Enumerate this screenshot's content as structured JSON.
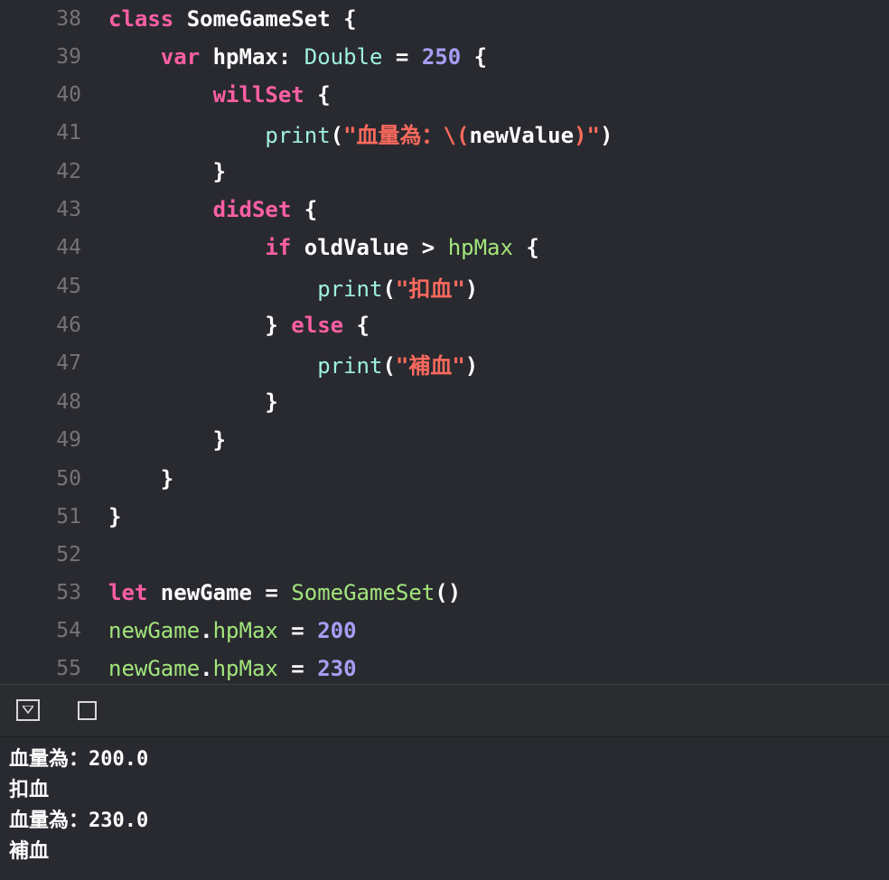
{
  "editor": {
    "lines": [
      {
        "no": "38",
        "parts": [
          [
            "kw",
            "class"
          ],
          [
            "plain",
            " SomeGameSet {"
          ]
        ]
      },
      {
        "no": "39",
        "parts": [
          [
            "plain",
            "    "
          ],
          [
            "kw",
            "var"
          ],
          [
            "plain",
            " hpMax: "
          ],
          [
            "type",
            "Double"
          ],
          [
            "plain",
            " = "
          ],
          [
            "num2",
            "250"
          ],
          [
            "plain",
            " {"
          ]
        ]
      },
      {
        "no": "40",
        "parts": [
          [
            "plain",
            "        "
          ],
          [
            "kw",
            "willSet"
          ],
          [
            "plain",
            " {"
          ]
        ]
      },
      {
        "no": "41",
        "parts": [
          [
            "plain",
            "            "
          ],
          [
            "fn",
            "print"
          ],
          [
            "plain",
            "("
          ],
          [
            "str",
            "\"血量為：\\("
          ],
          [
            "plain",
            "newValue"
          ],
          [
            "str",
            ")\""
          ],
          [
            "plain",
            ")"
          ]
        ]
      },
      {
        "no": "42",
        "parts": [
          [
            "plain",
            "        }"
          ]
        ]
      },
      {
        "no": "43",
        "parts": [
          [
            "plain",
            "        "
          ],
          [
            "kw",
            "didSet"
          ],
          [
            "plain",
            " {"
          ]
        ]
      },
      {
        "no": "44",
        "parts": [
          [
            "plain",
            "            "
          ],
          [
            "kw",
            "if"
          ],
          [
            "plain",
            " oldValue > "
          ],
          [
            "fnb",
            "hpMax"
          ],
          [
            "plain",
            " {"
          ]
        ]
      },
      {
        "no": "45",
        "parts": [
          [
            "plain",
            "                "
          ],
          [
            "fn",
            "print"
          ],
          [
            "plain",
            "("
          ],
          [
            "str",
            "\"扣血\""
          ],
          [
            "plain",
            ")"
          ]
        ]
      },
      {
        "no": "46",
        "parts": [
          [
            "plain",
            "            } "
          ],
          [
            "kw",
            "else"
          ],
          [
            "plain",
            " {"
          ]
        ]
      },
      {
        "no": "47",
        "parts": [
          [
            "plain",
            "                "
          ],
          [
            "fn",
            "print"
          ],
          [
            "plain",
            "("
          ],
          [
            "str",
            "\"補血\""
          ],
          [
            "plain",
            ")"
          ]
        ]
      },
      {
        "no": "48",
        "parts": [
          [
            "plain",
            "            }"
          ]
        ]
      },
      {
        "no": "49",
        "parts": [
          [
            "plain",
            "        }"
          ]
        ]
      },
      {
        "no": "50",
        "parts": [
          [
            "plain",
            "    }"
          ]
        ]
      },
      {
        "no": "51",
        "parts": [
          [
            "plain",
            "}"
          ]
        ]
      },
      {
        "no": "52",
        "parts": []
      },
      {
        "no": "53",
        "parts": [
          [
            "kw",
            "let"
          ],
          [
            "plain",
            " newGame = "
          ],
          [
            "fnb",
            "SomeGameSet"
          ],
          [
            "plain",
            "()"
          ]
        ]
      },
      {
        "no": "54",
        "parts": [
          [
            "fnb",
            "newGame"
          ],
          [
            "plain",
            "."
          ],
          [
            "fnb",
            "hpMax"
          ],
          [
            "plain",
            " = "
          ],
          [
            "num2",
            "200"
          ]
        ]
      },
      {
        "no": "55",
        "parts": [
          [
            "fnb",
            "newGame"
          ],
          [
            "plain",
            "."
          ],
          [
            "fnb",
            "hpMax"
          ],
          [
            "plain",
            " = "
          ],
          [
            "num2",
            "230"
          ]
        ]
      }
    ]
  },
  "debug_bar": {
    "toggle_icon": "hide-debug-area-icon",
    "square_icon": "stop-square-icon"
  },
  "console": {
    "output": [
      "血量為：200.0",
      "扣血",
      "血量為：230.0",
      "補血"
    ]
  }
}
